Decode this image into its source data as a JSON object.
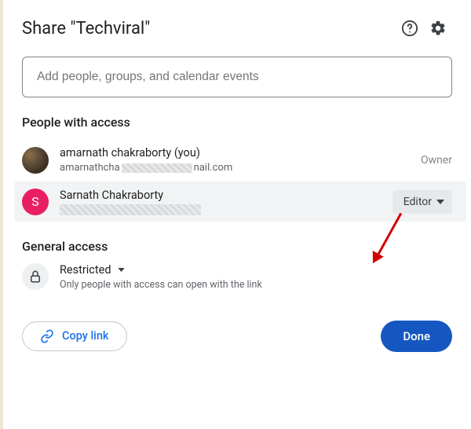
{
  "header": {
    "title": "Share \"Techviral\""
  },
  "input": {
    "placeholder": "Add people, groups, and calendar events"
  },
  "sections": {
    "people_title": "People with access",
    "general_title": "General access"
  },
  "people": [
    {
      "name": "amarnath chakraborty (you)",
      "email_prefix": "amarnathcha",
      "email_suffix": "nail.com",
      "role": "Owner",
      "avatar_letter": ""
    },
    {
      "name": "Sarnath Chakraborty",
      "email_prefix": "",
      "email_suffix": "",
      "role": "Editor",
      "avatar_letter": "S"
    }
  ],
  "general": {
    "mode": "Restricted",
    "desc": "Only people with access can open with the link"
  },
  "footer": {
    "copy": "Copy link",
    "done": "Done"
  }
}
